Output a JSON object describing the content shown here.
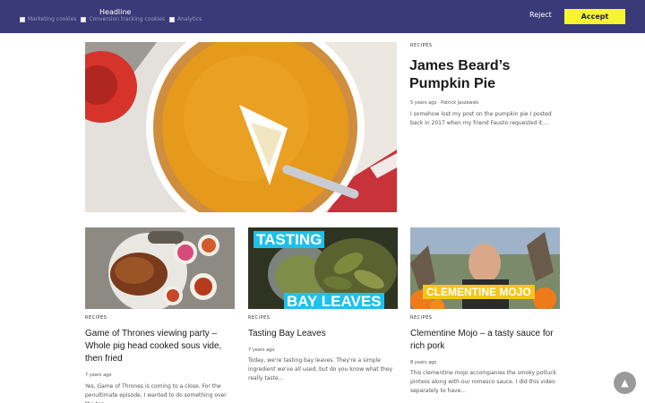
{
  "cookie": {
    "headline": "Headline",
    "options": [
      "Marketing cookies",
      "Conversion tracking cookies",
      "Analytics"
    ],
    "reject_label": "Reject",
    "accept_label": "Accept"
  },
  "featured": {
    "category": "RECIPES",
    "title": "James Beard’s Pumpkin Pie",
    "meta": "5 years ago · Patrick Jaszewski",
    "excerpt": "I somehow lost my post on the pumpkin pie I posted back in 2017 when my friend Fausto requested it...."
  },
  "cards": [
    {
      "category": "RECIPES",
      "title": "Game of Thrones viewing party – Whole pig head cooked sous vide, then fried",
      "meta": "7 years ago",
      "excerpt": "Yes, Game of Thrones is coming to a close. For the penultimate episode, I wanted to do something over the top..."
    },
    {
      "category": "RECIPES",
      "title": "Tasting Bay Leaves",
      "meta": "7 years ago",
      "excerpt": "Today, we're tasting bay leaves. They're a simple ingredient we've all used, but do you know what they really taste...",
      "banner_top": "TASTING",
      "banner_bottom": "BAY LEAVES"
    },
    {
      "category": "RECIPES",
      "title": "Clementine Mojo – a tasty sauce for rich pork",
      "meta": "8 years ago",
      "excerpt": "This clementine mojo accompanies the smoky potluck pintxos along with our romesco sauce. I did this video separately to have...",
      "banner": "CLEMENTINE MOJO"
    }
  ],
  "scroll_top_icon": "▲",
  "colors": {
    "banner_bg": "#3a3a78",
    "accent": "#f6f52e",
    "cyan": "#1ec1ea"
  }
}
